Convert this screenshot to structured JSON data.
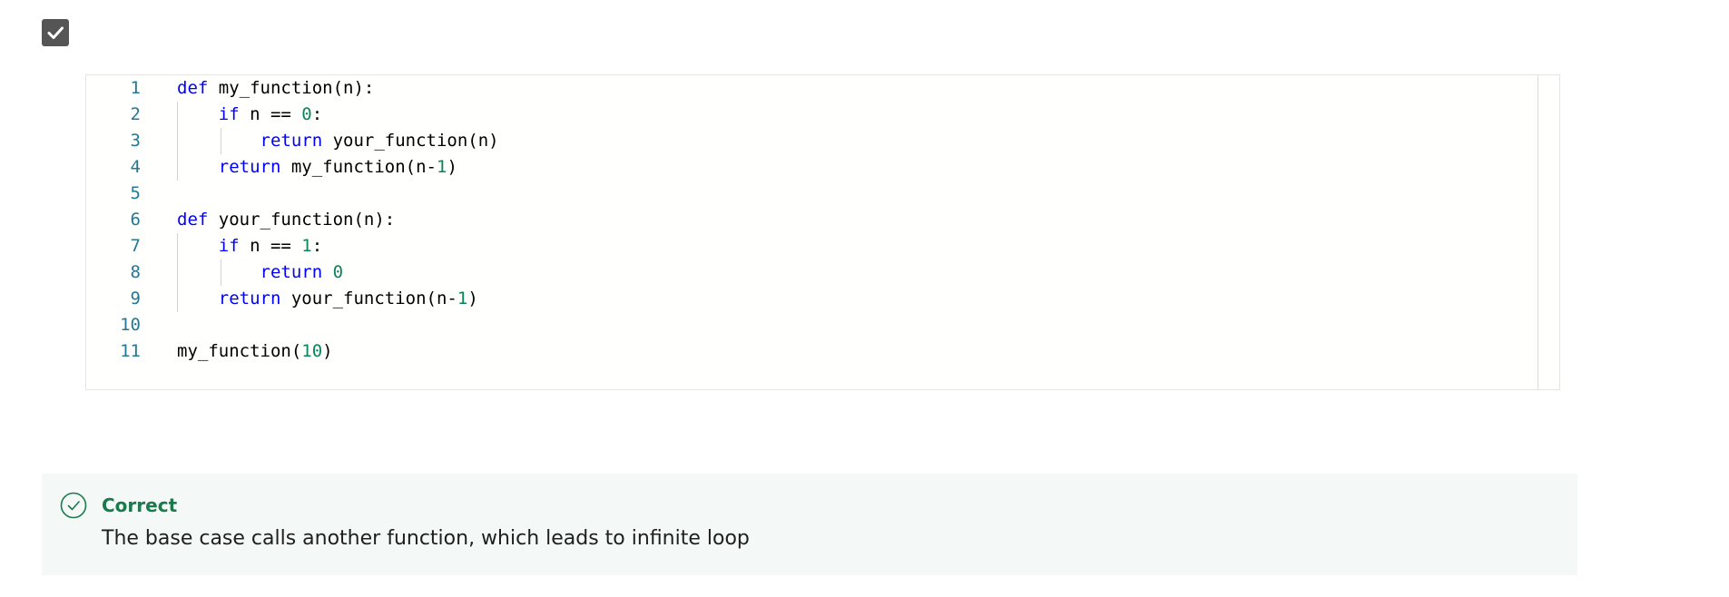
{
  "checkbox": {
    "checked": true,
    "icon": "check-icon"
  },
  "code": {
    "lines": [
      {
        "num": "1",
        "tokens": [
          {
            "t": "def",
            "c": "kw"
          },
          {
            "t": " my_function(n):",
            "c": ""
          }
        ]
      },
      {
        "num": "2",
        "tokens": [
          {
            "t": "    ",
            "c": ""
          },
          {
            "t": "if",
            "c": "kw"
          },
          {
            "t": " n == ",
            "c": ""
          },
          {
            "t": "0",
            "c": "num"
          },
          {
            "t": ":",
            "c": ""
          }
        ]
      },
      {
        "num": "3",
        "tokens": [
          {
            "t": "        ",
            "c": ""
          },
          {
            "t": "return",
            "c": "kw"
          },
          {
            "t": " your_function(n)",
            "c": ""
          }
        ]
      },
      {
        "num": "4",
        "tokens": [
          {
            "t": "    ",
            "c": ""
          },
          {
            "t": "return",
            "c": "kw"
          },
          {
            "t": " my_function(n-",
            "c": ""
          },
          {
            "t": "1",
            "c": "num"
          },
          {
            "t": ")",
            "c": ""
          }
        ]
      },
      {
        "num": "5",
        "tokens": []
      },
      {
        "num": "6",
        "tokens": [
          {
            "t": "def",
            "c": "kw"
          },
          {
            "t": " your_function(n):",
            "c": ""
          }
        ]
      },
      {
        "num": "7",
        "tokens": [
          {
            "t": "    ",
            "c": ""
          },
          {
            "t": "if",
            "c": "kw"
          },
          {
            "t": " n == ",
            "c": ""
          },
          {
            "t": "1",
            "c": "num"
          },
          {
            "t": ":",
            "c": ""
          }
        ]
      },
      {
        "num": "8",
        "tokens": [
          {
            "t": "        ",
            "c": ""
          },
          {
            "t": "return",
            "c": "kw"
          },
          {
            "t": " ",
            "c": ""
          },
          {
            "t": "0",
            "c": "num"
          }
        ]
      },
      {
        "num": "9",
        "tokens": [
          {
            "t": "    ",
            "c": ""
          },
          {
            "t": "return",
            "c": "kw"
          },
          {
            "t": " your_function(n-",
            "c": ""
          },
          {
            "t": "1",
            "c": "num"
          },
          {
            "t": ")",
            "c": ""
          }
        ]
      },
      {
        "num": "10",
        "tokens": []
      },
      {
        "num": "11",
        "tokens": [
          {
            "t": "my_function(",
            "c": ""
          },
          {
            "t": "10",
            "c": "num"
          },
          {
            "t": ")",
            "c": ""
          }
        ]
      }
    ]
  },
  "feedback": {
    "status": "Correct",
    "message": "The base case calls another function, which leads to infinite loop",
    "icon": "check-circle-icon",
    "color": "#1a7a4c"
  },
  "colors": {
    "keyword": "#0000ff",
    "number": "#098658",
    "line_number": "#237893"
  }
}
